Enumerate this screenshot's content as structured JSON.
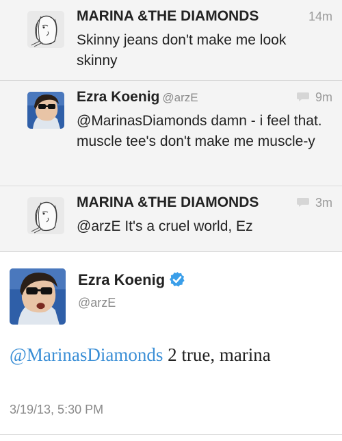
{
  "replies": [
    {
      "name": "MARINA &THE DIAMONDS",
      "handle": "",
      "time": "14m",
      "has_reply_icon": false,
      "text": "Skinny jeans don't make me look skinny",
      "avatar": "sketch-portrait-avatar"
    },
    {
      "name": "Ezra Koenig",
      "handle": "@arzE",
      "time": "9m",
      "has_reply_icon": true,
      "text": "@MarinasDiamonds damn - i feel that. muscle tee's don't make me muscle-y",
      "avatar": "photo-glasses-avatar"
    },
    {
      "name": "MARINA &THE DIAMONDS",
      "handle": "",
      "time": "3m",
      "has_reply_icon": true,
      "text": "@arzE It's a cruel world, Ez",
      "avatar": "sketch-portrait-avatar"
    }
  ],
  "main_tweet": {
    "name": "Ezra Koenig",
    "handle": "@arzE",
    "verified": true,
    "mention": "@MarinasDiamonds",
    "text": " 2 true, marina",
    "timestamp": "3/19/13, 5:30 PM",
    "avatar": "photo-glasses-avatar"
  },
  "colors": {
    "mention": "#3b8fd6",
    "verified_badge": "#3a9ee9",
    "reply_background": "#f4f4f4"
  },
  "icons": [
    "speech-bubble-icon",
    "verified-badge-icon"
  ]
}
